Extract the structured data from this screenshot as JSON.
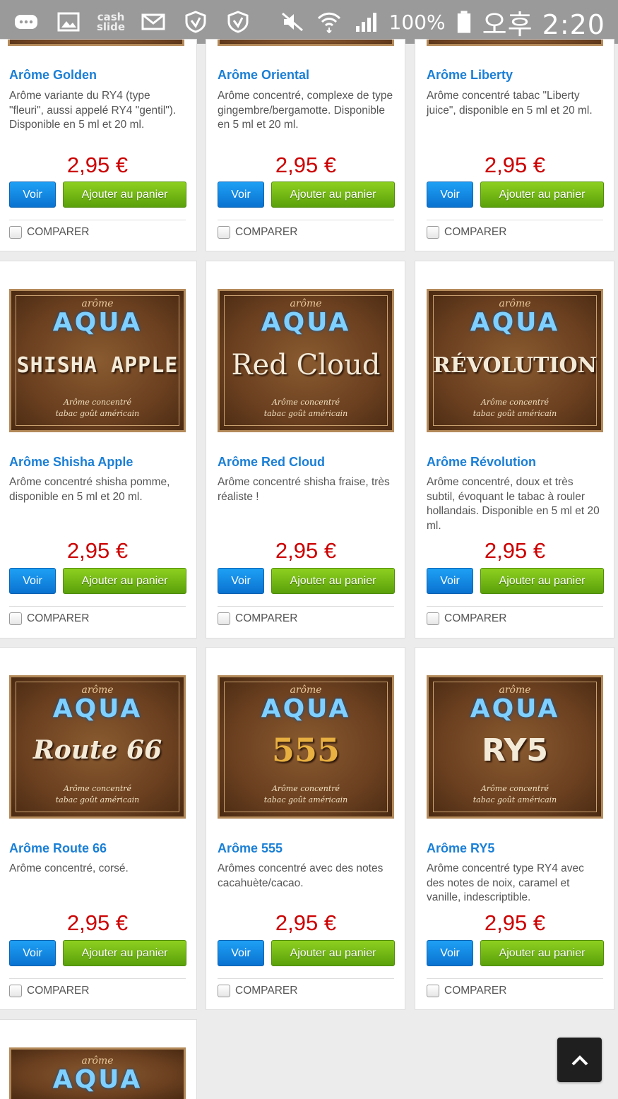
{
  "status_bar": {
    "cash_slide": "cash\nslide",
    "battery": "100%",
    "time": "오후 2:20",
    "icons": [
      "chat-icon",
      "gallery-icon",
      "cashslide-icon",
      "mail-icon",
      "v3-shield-icon",
      "v3-shield-icon",
      "mute-icon",
      "wifi-icon",
      "signal-icon",
      "battery-icon"
    ]
  },
  "shop": {
    "currency_price": "2,95 €",
    "voir_label": "Voir",
    "add_label": "Ajouter au panier",
    "compare_label": "COMPARER",
    "thumb_top": "arôme",
    "thumb_brand": "AQUA",
    "thumb_sub_1": "Arôme concentré",
    "thumb_sub_2": "tabac goût américain",
    "products": [
      {
        "title": "Arôme Golden",
        "desc": "Arôme variante du RY4 (type \"fleuri\", aussi appelé RY4 \"gentil\"). Disponible en 5 ml et 20 ml.",
        "price": "2,95 €"
      },
      {
        "title": "Arôme Oriental",
        "desc": "Arôme concentré, complexe de type gingembre/bergamotte. Disponible en 5 ml et 20 ml.",
        "price": "2,95 €"
      },
      {
        "title": "Arôme Liberty",
        "desc": "Arôme concentré tabac \"Liberty juice\", disponible en 5 ml et 20 ml.",
        "price": "2,95 €"
      },
      {
        "title": "Arôme Shisha Apple",
        "desc": "Arôme concentré shisha pomme, disponible en 5 ml et 20 ml.",
        "price": "2,95 €",
        "thumb_name": "SHISHA APPLE"
      },
      {
        "title": "Arôme Red Cloud",
        "desc": "Arôme concentré shisha fraise, très réaliste !",
        "price": "2,95 €",
        "thumb_name": "Red Cloud"
      },
      {
        "title": "Arôme Révolution",
        "desc": "Arôme concentré, doux et très subtil, évoquant le tabac à rouler hollandais. Disponible en 5 ml et 20 ml.",
        "price": "2,95 €",
        "thumb_name": "RÉVOLUTION"
      },
      {
        "title": "Arôme Route 66",
        "desc": "Arôme concentré, corsé.",
        "price": "2,95 €",
        "thumb_name": "Route 66"
      },
      {
        "title": "Arôme 555",
        "desc": "Arômes concentré avec des notes cacahuète/cacao.",
        "price": "2,95 €",
        "thumb_name": "555"
      },
      {
        "title": "Arôme RY5",
        "desc": "Arôme concentré type RY4 avec des notes de noix, caramel et vanille, indescriptible.",
        "price": "2,95 €",
        "thumb_name": "RY5"
      }
    ]
  },
  "colors": {
    "title_blue": "#1a7fd6",
    "price_red": "#cc0000",
    "voir_blue": "#0a72d0",
    "add_green": "#5aa00a"
  }
}
